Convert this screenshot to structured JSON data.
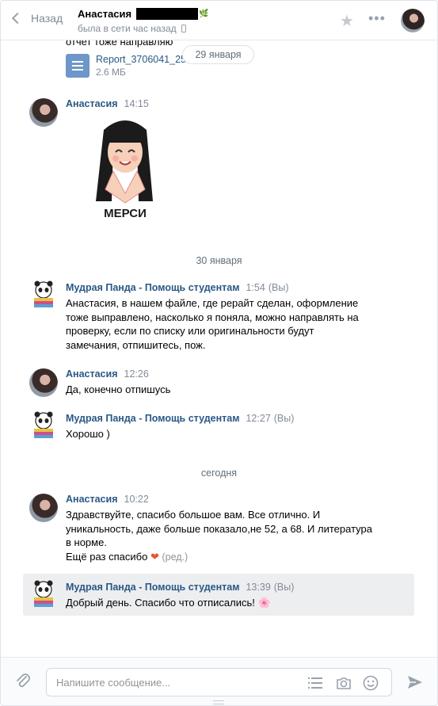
{
  "header": {
    "back_label": "Назад",
    "contact_name": "Анастасия",
    "status": "была в сети час назад"
  },
  "prev": {
    "text": "отчет тоже направляю",
    "file_name": "Report_3706041_25...",
    "file_size": "2.6 МБ",
    "date_pill": "29 января"
  },
  "messages": [
    {
      "author": "Анастасия",
      "time": "14:15",
      "sticker_text": "МЕРСИ"
    },
    {
      "author": "Мудрая Панда - Помощь студентам",
      "time": "1:54",
      "you": "(Вы)",
      "lines": [
        "Анастасия, в нашем файле, где рерайт сделан, оформление",
        "тоже выправлено, насколько я поняла, можно направлять на",
        "проверку, если по списку или оригинальности будут",
        "замечания, отпишитесь, пож."
      ]
    },
    {
      "author": "Анастасия",
      "time": "12:26",
      "lines": [
        "Да, конечно отпишусь"
      ]
    },
    {
      "author": "Мудрая Панда - Помощь студентам",
      "time": "12:27",
      "you": "(Вы)",
      "lines": [
        "Хорошо )"
      ]
    },
    {
      "author": "Анастасия",
      "time": "10:22",
      "lines": [
        "Здравствуйте, спасибо большое вам. Все отлично. И",
        "уникальность, даже больше показало,не 52, а 68. И литература",
        "в норме.",
        "Ещё раз спасибо"
      ],
      "heart": "❤",
      "edited": "(ред.)"
    },
    {
      "author": "Мудрая Панда - Помощь студентам",
      "time": "13:39",
      "you": "(Вы)",
      "lines": [
        "Добрый день. Спасибо что отписались!"
      ],
      "flower": "🌸"
    }
  ],
  "dates": {
    "d1": "30 января",
    "d2": "сегодня"
  },
  "composer": {
    "placeholder": "Напишите сообщение..."
  },
  "colors": {
    "link": "#2a5885",
    "muted": "#828a99",
    "highlight": "#edeef0"
  }
}
